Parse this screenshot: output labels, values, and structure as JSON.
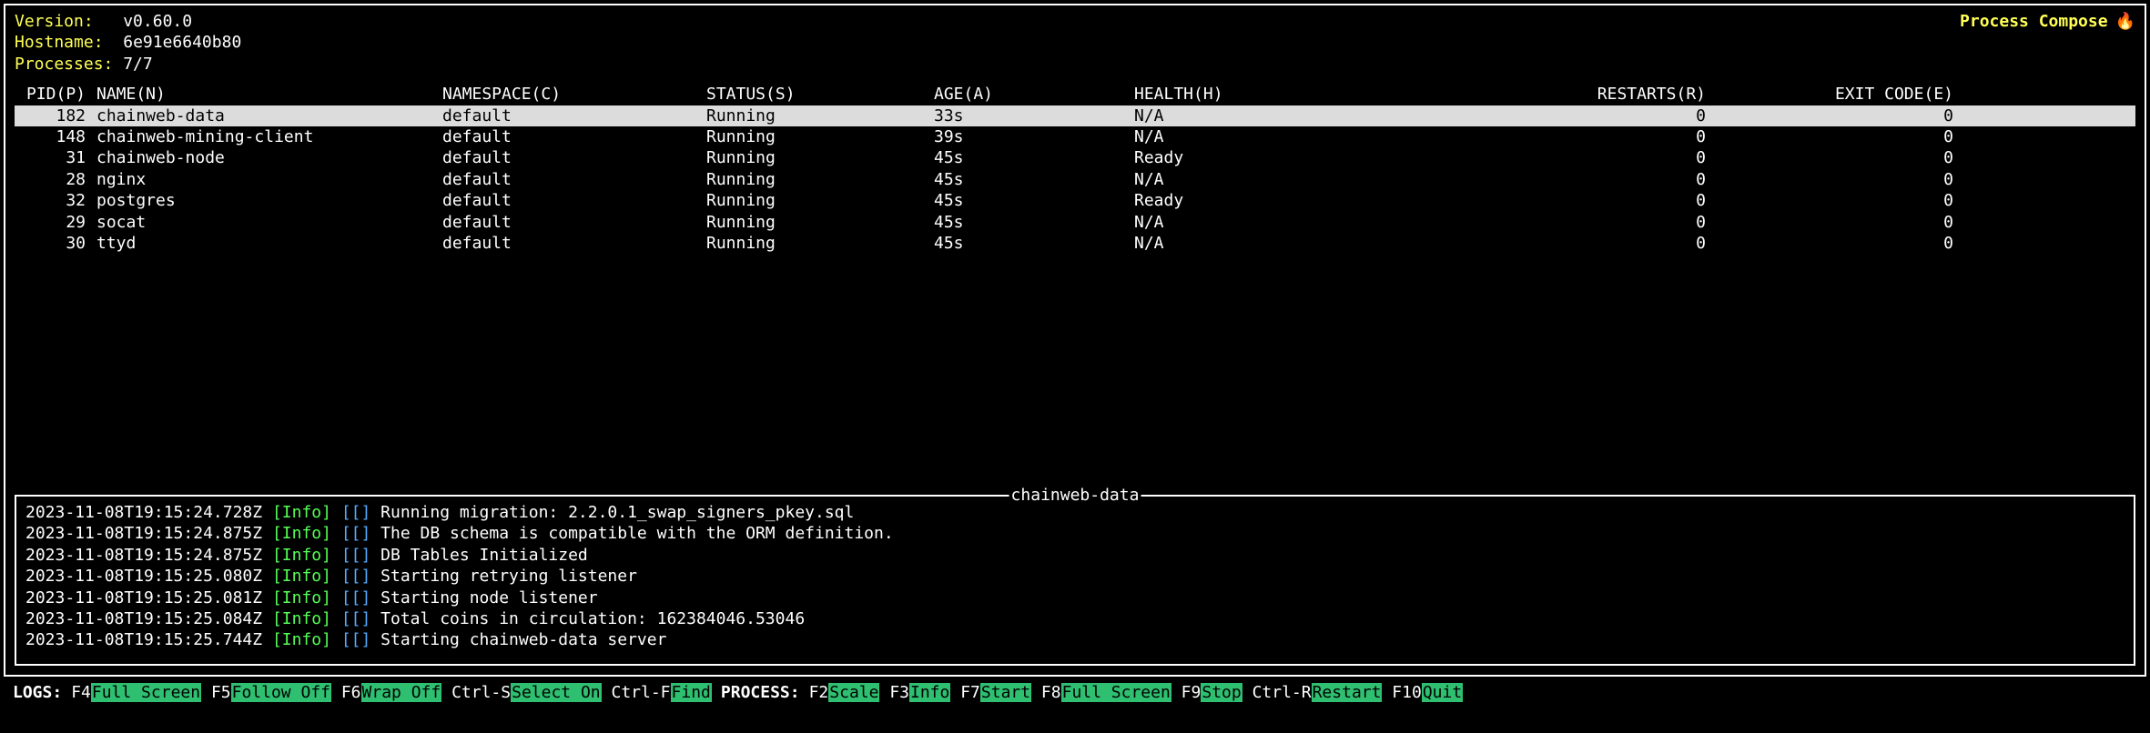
{
  "header": {
    "version_label": "Version:",
    "version_value": "v0.60.0",
    "hostname_label": "Hostname:",
    "hostname_value": "6e91e6640b80",
    "processes_label": "Processes:",
    "processes_value": "7/7",
    "app_title": "Process Compose",
    "flame": "🔥"
  },
  "table": {
    "columns": {
      "pid": "PID(P)",
      "name": "NAME(N)",
      "namespace": "NAMESPACE(C)",
      "status": "STATUS(S)",
      "age": "AGE(A)",
      "health": "HEALTH(H)",
      "restarts": "RESTARTS(R)",
      "exit_code": "EXIT CODE(E)"
    },
    "rows": [
      {
        "pid": "182",
        "name": "chainweb-data",
        "namespace": "default",
        "status": "Running",
        "age": "33s",
        "health": "N/A",
        "restarts": "0",
        "exit_code": "0",
        "selected": true
      },
      {
        "pid": "148",
        "name": "chainweb-mining-client",
        "namespace": "default",
        "status": "Running",
        "age": "39s",
        "health": "N/A",
        "restarts": "0",
        "exit_code": "0",
        "selected": false
      },
      {
        "pid": "31",
        "name": "chainweb-node",
        "namespace": "default",
        "status": "Running",
        "age": "45s",
        "health": "Ready",
        "restarts": "0",
        "exit_code": "0",
        "selected": false
      },
      {
        "pid": "28",
        "name": "nginx",
        "namespace": "default",
        "status": "Running",
        "age": "45s",
        "health": "N/A",
        "restarts": "0",
        "exit_code": "0",
        "selected": false
      },
      {
        "pid": "32",
        "name": "postgres",
        "namespace": "default",
        "status": "Running",
        "age": "45s",
        "health": "Ready",
        "restarts": "0",
        "exit_code": "0",
        "selected": false
      },
      {
        "pid": "29",
        "name": "socat",
        "namespace": "default",
        "status": "Running",
        "age": "45s",
        "health": "N/A",
        "restarts": "0",
        "exit_code": "0",
        "selected": false
      },
      {
        "pid": "30",
        "name": "ttyd",
        "namespace": "default",
        "status": "Running",
        "age": "45s",
        "health": "N/A",
        "restarts": "0",
        "exit_code": "0",
        "selected": false
      }
    ]
  },
  "log": {
    "title": "chainweb-data",
    "level_tag": "[Info]",
    "bracket_tag": "[[]",
    "lines": [
      {
        "ts": "2023-11-08T19:15:24.728Z",
        "msg": "Running migration: 2.2.0.1_swap_signers_pkey.sql"
      },
      {
        "ts": "2023-11-08T19:15:24.875Z",
        "msg": "The DB schema is compatible with the ORM definition."
      },
      {
        "ts": "2023-11-08T19:15:24.875Z",
        "msg": "DB Tables Initialized"
      },
      {
        "ts": "2023-11-08T19:15:25.080Z",
        "msg": "Starting retrying listener"
      },
      {
        "ts": "2023-11-08T19:15:25.081Z",
        "msg": "Starting node listener"
      },
      {
        "ts": "2023-11-08T19:15:25.084Z",
        "msg": "Total coins in circulation: 162384046.53046"
      },
      {
        "ts": "2023-11-08T19:15:25.744Z",
        "msg": "Starting chainweb-data server"
      }
    ]
  },
  "footer": {
    "logs_label": "LOGS:",
    "process_label": "PROCESS:",
    "logs": [
      {
        "key": "F4",
        "act": "Full Screen"
      },
      {
        "key": "F5",
        "act": "Follow Off"
      },
      {
        "key": "F6",
        "act": "Wrap Off"
      },
      {
        "key": "Ctrl-S",
        "act": "Select On"
      },
      {
        "key": "Ctrl-F",
        "act": "Find"
      }
    ],
    "process": [
      {
        "key": "F2",
        "act": "Scale"
      },
      {
        "key": "F3",
        "act": "Info"
      },
      {
        "key": "F7",
        "act": "Start"
      },
      {
        "key": "F8",
        "act": "Full Screen"
      },
      {
        "key": "F9",
        "act": "Stop"
      },
      {
        "key": "Ctrl-R",
        "act": "Restart"
      },
      {
        "key": "F10",
        "act": "Quit"
      }
    ]
  }
}
